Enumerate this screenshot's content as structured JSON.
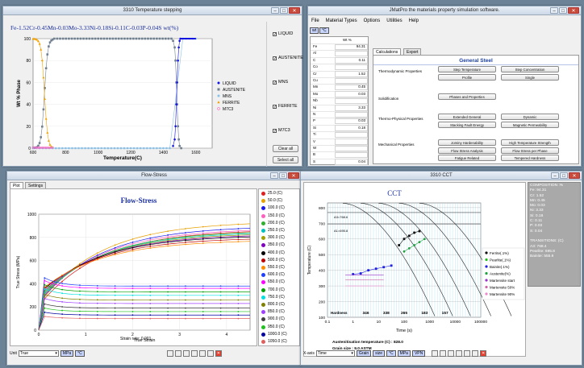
{
  "win1": {
    "title": "3310 Temperature stepping",
    "formula": "Fe-1.52Cr-0.45Mn-0.03Mo-3.33Ni-0.18Si-0.11C-0.03P-0.04S wt(%)",
    "ylabel": "Wt % Phase",
    "xlabel": "Temperature(C)",
    "yticks": [
      "100",
      "80",
      "60",
      "40",
      "20",
      "0"
    ],
    "xticks": [
      "600",
      "800",
      "1000",
      "1200",
      "1400",
      "1600"
    ],
    "legend": [
      "LIQUID",
      "AUSTENITE",
      "MNS",
      "FERRITE",
      "M7C3"
    ],
    "checks": [
      "LIQUID",
      "AUSTENITE",
      "MNS",
      "FERRITE",
      "M7C3"
    ],
    "clear": "Clear all",
    "select": "Select all"
  },
  "win2": {
    "title": "JMatPro the materials property simulation software.",
    "menu": [
      "File",
      "Material Types",
      "Options",
      "Utilities",
      "Help"
    ],
    "tool1": "wt",
    "tool2": "°C",
    "col_hdr": "Wt %",
    "elements": [
      "Fe",
      "Al",
      "C",
      "Co",
      "Cr",
      "Cu",
      "Mn",
      "Mo",
      "Nb",
      "Ni",
      "N",
      "P",
      "Si",
      "Ti",
      "V",
      "W",
      "B",
      "S"
    ],
    "values": [
      "94.31",
      "",
      "0.11",
      "",
      "1.52",
      "",
      "0.45",
      "0.03",
      "",
      "3.33",
      "",
      "0.03",
      "0.18",
      "",
      "",
      "",
      "",
      "0.04"
    ],
    "tabs": [
      "Calculations",
      "Export"
    ],
    "group_title": "General Steel",
    "sections": [
      {
        "label": "Thermodynamic Properties",
        "buttons": [
          "Step Temperature",
          "Step Concentration",
          "Profile",
          "Single"
        ]
      },
      {
        "label": "Solidification",
        "buttons": [
          "Phases and Properties"
        ]
      },
      {
        "label": "Thermo-Physical Properties",
        "buttons": [
          "Extended General",
          "Dynamic",
          "Stacking Fault Energy",
          "Magnetic Permeability"
        ]
      },
      {
        "label": "Mechanical Properties",
        "buttons": [
          "Jominy Hardenability",
          "High Temperature Strength",
          "Flow Stress Analysis",
          "Flow Stress per Phase",
          "Fatigue Related",
          "Tempered Hardness"
        ]
      }
    ]
  },
  "win3": {
    "title": "Flow-Stress",
    "tabs": [
      "Plot",
      "Settings"
    ],
    "chart_title": "Flow-Stress",
    "ylabel": "True Stress (MPa)",
    "xlabel": "True Strain",
    "yticks": [
      "1000",
      "800",
      "600",
      "400",
      "200",
      "0"
    ],
    "xticks": [
      "0",
      "1",
      "2",
      "3",
      "4"
    ],
    "strain_rate": "Strain rate: 0.001",
    "unit_label": "Unit",
    "unit_value": "True",
    "mpa": "MPa",
    "degc": "°C",
    "legend": [
      "25.0 (C)",
      "50.0 (C)",
      "100.0 (C)",
      "150.0 (C)",
      "200.0 (C)",
      "250.0 (C)",
      "300.0 (C)",
      "350.0 (C)",
      "400.0 (C)",
      "500.0 (C)",
      "550.0 (C)",
      "600.0 (C)",
      "650.0 (C)",
      "700.0 (C)",
      "750.0 (C)",
      "800.0 (C)",
      "850.0 (C)",
      "900.0 (C)",
      "950.0 (C)",
      "1000.0 (C)",
      "1050.0 (C)"
    ],
    "colors": [
      "#e02020",
      "#e8a000",
      "#1a1aee",
      "#ff60c0",
      "#30b030",
      "#00c0c0",
      "#a0a000",
      "#8000c0",
      "#000000",
      "#c00000",
      "#ff8c00",
      "#2040ff",
      "#ff00ff",
      "#00a000",
      "#00e0e0",
      "#808000",
      "#a040ff",
      "#404040",
      "#20c020",
      "#0000a0",
      "#e06060"
    ]
  },
  "win4": {
    "title": "3310 CCT",
    "chart_title": "CCT",
    "ylabel": "Temperature (C)",
    "xlabel": "Time (s)",
    "yticks": [
      "800",
      "700",
      "600",
      "500",
      "400",
      "300",
      "200",
      "100"
    ],
    "xticks": [
      "0.1",
      "1",
      "10",
      "100",
      "1000",
      "10000",
      "100000"
    ],
    "a3": "A3=768.6",
    "a1": "A1=695.8",
    "hardness": "Hardness",
    "hv": [
      "346",
      "338",
      "265",
      "183",
      "157"
    ],
    "legend": [
      "Ferrite(.1%)",
      "Pearlite(.1%)",
      "Bainite(.1%)",
      "Austenite(%)",
      "Martensite start",
      "Martensite 50%",
      "Martensite 90%"
    ],
    "aust": "Austenitisation temperature (C) : 828.0",
    "grain": "Grain size : 9.0 ASTM",
    "xaxis_label": "X-axis",
    "xaxis_value": "Time",
    "grain_btn": "Grain",
    "size_btn": "size",
    "degc": "°C",
    "mpa": "MPa",
    "vpn": "VPN",
    "composition": [
      "COMPOSITION :%",
      "Fe: 94.31",
      "Cr: 1.52",
      "Mn: 0.45",
      "Mo: 0.03",
      "Ni: 3.33",
      "Si: 0.18",
      "C: 0.11",
      "P: 0.03",
      "S: 0.04",
      "",
      "TRANSITIONS: (C)",
      "A3: 768.4",
      "Pearlite: 695.8",
      "Bainite: 555.9"
    ]
  }
}
